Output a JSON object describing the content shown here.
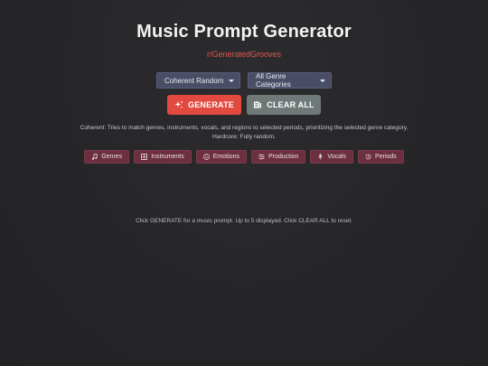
{
  "header": {
    "title": "Music Prompt Generator",
    "subtitle": "r/GeneratedGrooves"
  },
  "controls": {
    "mode_select": {
      "value": "Coherent Random"
    },
    "genre_select": {
      "value": "All Genre Categories"
    }
  },
  "actions": {
    "generate_label": "GENERATE",
    "clear_label": "CLEAR ALL"
  },
  "description": {
    "line1": "Coherent: Tries to match genres, instruments, vocals, and regions to selected periods, prioritizing the selected genre category.",
    "line2": "Hardcore: Fully random."
  },
  "chips": [
    {
      "label": "Genres",
      "icon": "music-note-icon"
    },
    {
      "label": "Instruments",
      "icon": "grid-icon"
    },
    {
      "label": "Emotions",
      "icon": "smiley-icon"
    },
    {
      "label": "Production",
      "icon": "sliders-icon"
    },
    {
      "label": "Vocals",
      "icon": "microphone-icon"
    },
    {
      "label": "Periods",
      "icon": "history-icon"
    }
  ],
  "hint": "Click GENERATE for a music prompt. Up to 5 displayed. Click CLEAR ALL to reset.",
  "colors": {
    "background": "#262628",
    "accent_red": "#e2493f",
    "subtitle_red": "#e2564b",
    "select_bg": "#4a4d66",
    "clear_bg": "#6f7a78",
    "chip_bg": "#6b2f40"
  }
}
